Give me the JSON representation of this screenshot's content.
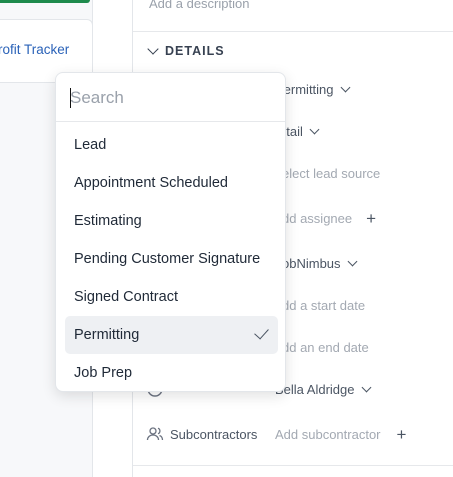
{
  "left_panel": {
    "profit_tracker_link": "rofit Tracker",
    "accent_color": "#1e8a4c"
  },
  "main": {
    "description_placeholder": "Add a description",
    "details_header": "DETAILS",
    "fields": [
      {
        "label": "",
        "value": "Permitting",
        "icon": "status-icon",
        "has_chevron": true
      },
      {
        "label": "",
        "value": "etail",
        "icon": "type-icon",
        "has_chevron": true
      },
      {
        "label": "",
        "value": "elect lead source",
        "icon": "lead-source-icon",
        "muted": true
      },
      {
        "label": "",
        "value": "dd assignee",
        "icon": "assignee-icon",
        "muted": true,
        "has_plus": true
      },
      {
        "label": "",
        "value": "obNimbus",
        "icon": "source-icon",
        "has_chevron": true
      },
      {
        "label": "",
        "value": "dd a start date",
        "icon": "calendar-icon",
        "muted": true
      },
      {
        "label": "",
        "value": "dd an end date",
        "icon": "calendar-icon",
        "muted": true
      },
      {
        "label": "",
        "value": "Bella Aldridge",
        "icon": "sales-rep-icon",
        "has_chevron": true
      },
      {
        "label": "Subcontractors",
        "value": "Add subcontractor",
        "icon": "users-icon",
        "muted": true,
        "has_plus": true
      }
    ]
  },
  "dropdown": {
    "search_placeholder": "Search",
    "options": [
      {
        "label": "Lead",
        "selected": false
      },
      {
        "label": "Appointment Scheduled",
        "selected": false
      },
      {
        "label": "Estimating",
        "selected": false
      },
      {
        "label": "Pending Customer Signature",
        "selected": false
      },
      {
        "label": "Signed Contract",
        "selected": false
      },
      {
        "label": "Permitting",
        "selected": true
      },
      {
        "label": "Job Prep",
        "selected": false
      }
    ]
  }
}
